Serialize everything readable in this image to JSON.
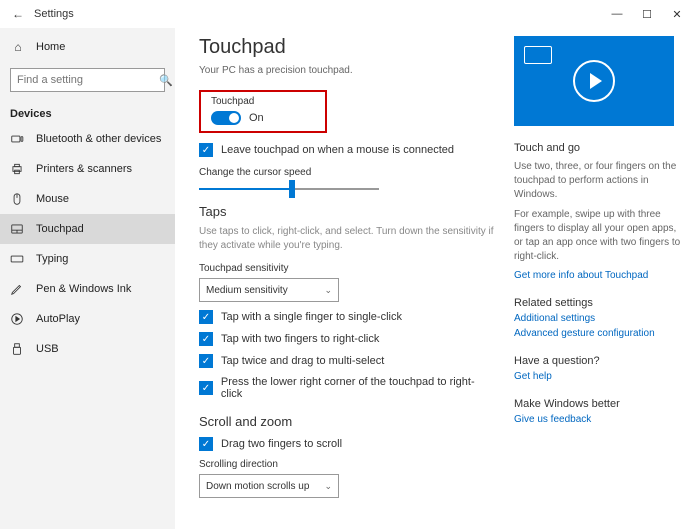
{
  "window": {
    "title": "Settings",
    "min": "—",
    "max": "☐",
    "close": "✕"
  },
  "sidebar": {
    "home": "Home",
    "search_placeholder": "Find a setting",
    "section": "Devices",
    "items": [
      {
        "label": "Bluetooth & other devices"
      },
      {
        "label": "Printers & scanners"
      },
      {
        "label": "Mouse"
      },
      {
        "label": "Touchpad"
      },
      {
        "label": "Typing"
      },
      {
        "label": "Pen & Windows Ink"
      },
      {
        "label": "AutoPlay"
      },
      {
        "label": "USB"
      }
    ]
  },
  "main": {
    "title": "Touchpad",
    "precision": "Your PC has a precision touchpad.",
    "toggle_label": "Touchpad",
    "toggle_state": "On",
    "leave_on": "Leave touchpad on when a mouse is connected",
    "cursor_speed": "Change the cursor speed",
    "taps_h": "Taps",
    "taps_desc": "Use taps to click, right-click, and select. Turn down the sensitivity if they activate while you're typing.",
    "sensitivity_label": "Touchpad sensitivity",
    "sensitivity_value": "Medium sensitivity",
    "tap1": "Tap with a single finger to single-click",
    "tap2": "Tap with two fingers to right-click",
    "tap3": "Tap twice and drag to multi-select",
    "tap4": "Press the lower right corner of the touchpad to right-click",
    "scroll_h": "Scroll and zoom",
    "drag2": "Drag two fingers to scroll",
    "scrolldir_label": "Scrolling direction",
    "scrolldir_value": "Down motion scrolls up"
  },
  "right": {
    "touchgo_h": "Touch and go",
    "touchgo_p1": "Use two, three, or four fingers on the touchpad to perform actions in Windows.",
    "touchgo_p2": "For example, swipe up with three fingers to display all your open apps, or tap an app once with two fingers to right-click.",
    "more_info": "Get more info about Touchpad",
    "related_h": "Related settings",
    "related1": "Additional settings",
    "related2": "Advanced gesture configuration",
    "question_h": "Have a question?",
    "help": "Get help",
    "better_h": "Make Windows better",
    "feedback": "Give us feedback"
  }
}
